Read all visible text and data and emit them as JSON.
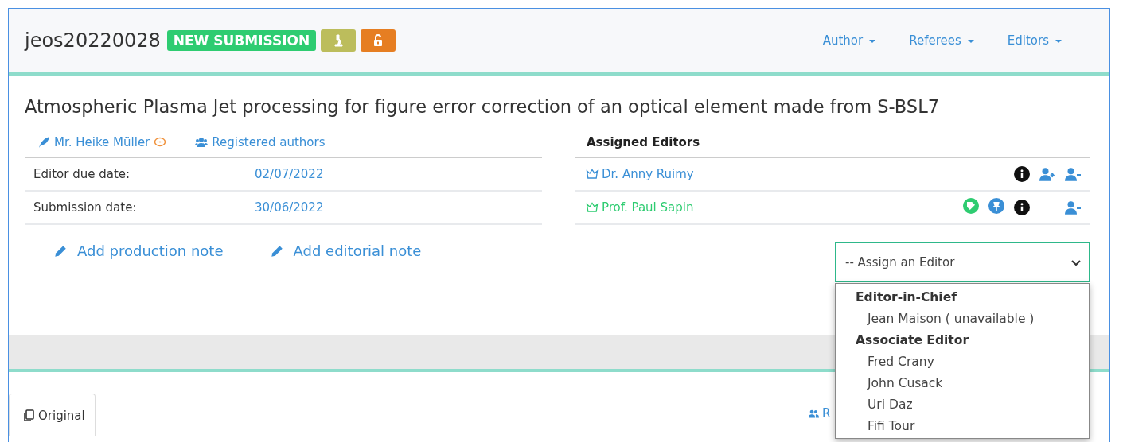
{
  "header": {
    "id": "jeos20220028",
    "status": "NEW SUBMISSION",
    "menus": [
      "Author",
      "Referees",
      "Editors"
    ]
  },
  "title": "Atmospheric Plasma Jet processing for figure error correction of an optical element made from S-BSL7",
  "author": {
    "name": "Mr. Heike Müller",
    "link": "Registered authors"
  },
  "dates": [
    {
      "label": "Editor due date:",
      "value": "02/07/2022"
    },
    {
      "label": "Submission date:",
      "value": "30/06/2022"
    }
  ],
  "notes": [
    "Add production note",
    "Add editorial note"
  ],
  "assigned": {
    "heading": "Assigned Editors",
    "editors": [
      {
        "name": "Dr. Anny Ruimy",
        "color": "#3a8fd6",
        "tagged": false,
        "pinned": false,
        "reassign": true
      },
      {
        "name": "Prof. Paul Sapin",
        "color": "#2ecc71",
        "tagged": true,
        "pinned": true,
        "reassign": false
      }
    ]
  },
  "assign_select": {
    "value": "-- Assign an Editor",
    "expanded": true,
    "groups": [
      {
        "label": "Editor-in-Chief",
        "options": [
          "Jean Maison ( unavailable )"
        ]
      },
      {
        "label": "Associate Editor",
        "options": [
          "Fred Crany",
          "John Cusack",
          "Uri Daz",
          "Fifi Tour"
        ]
      }
    ]
  },
  "tabs": [
    {
      "label": "Original",
      "selected": true
    }
  ],
  "side_link": "R"
}
